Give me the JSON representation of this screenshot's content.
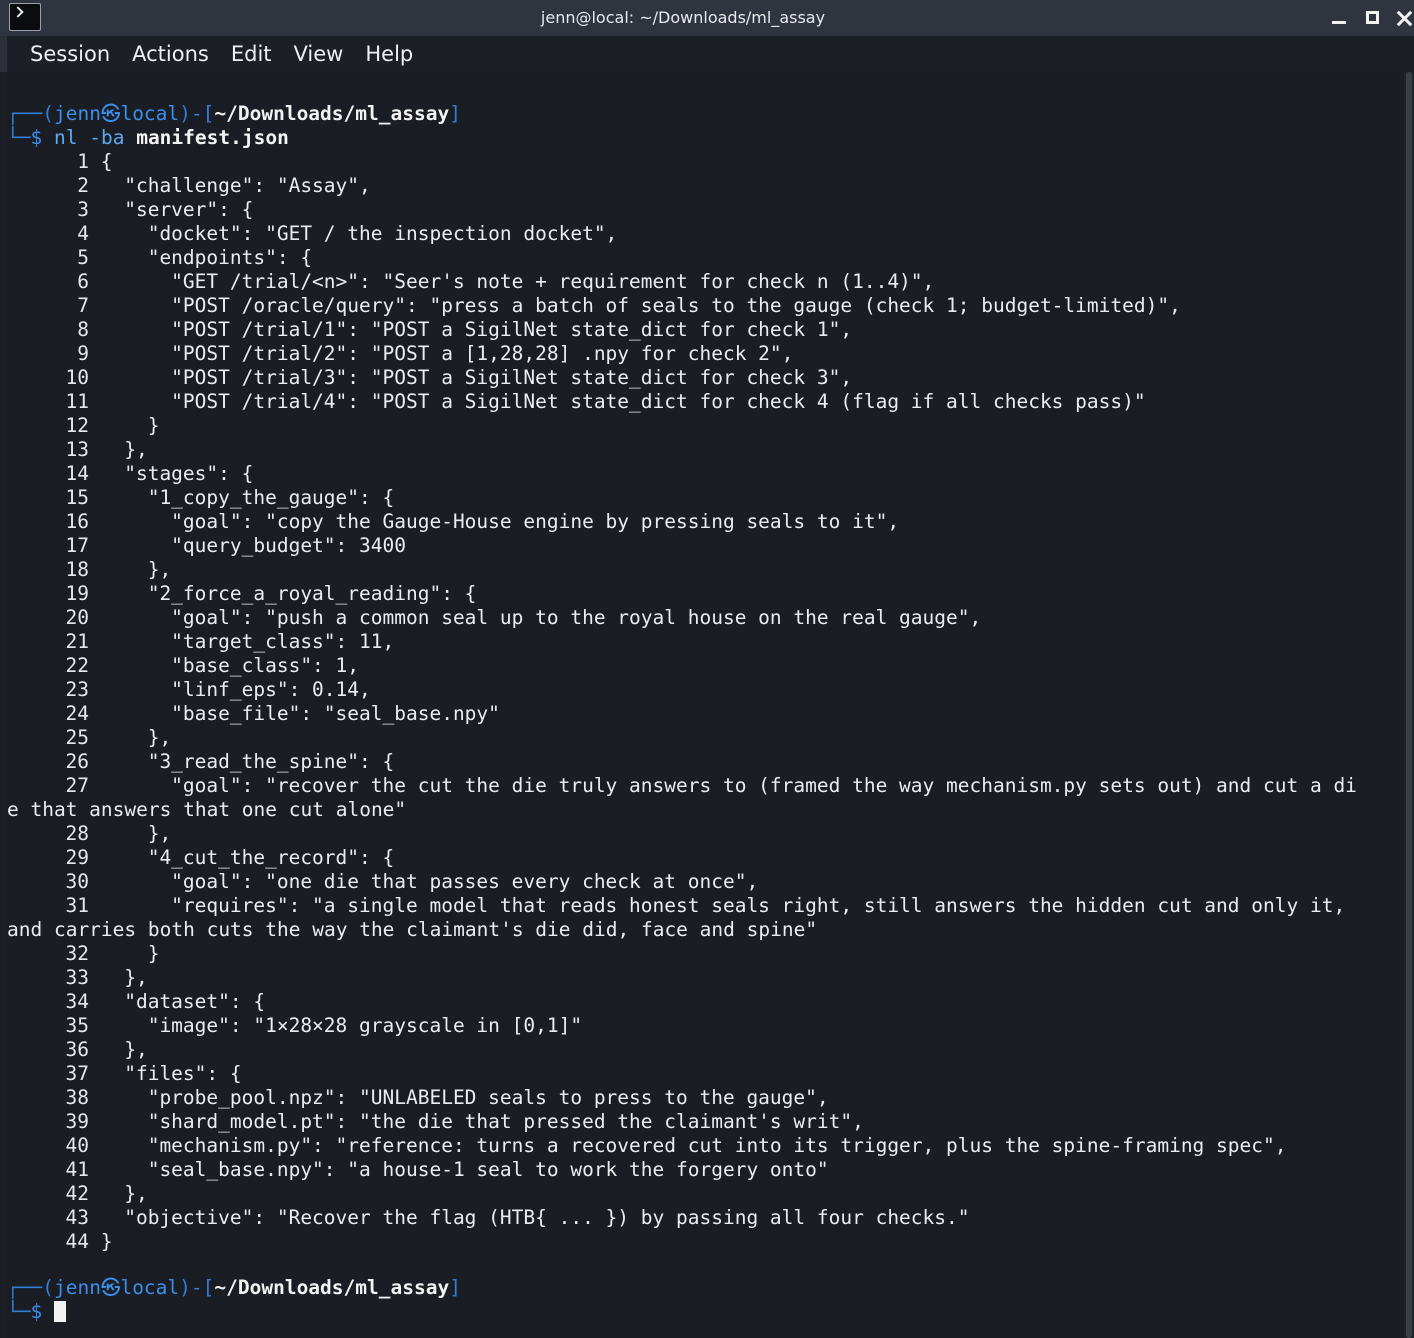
{
  "window": {
    "title": "jenn@local: ~/Downloads/ml_assay"
  },
  "menu": [
    "Session",
    "Actions",
    "Edit",
    "View",
    "Help"
  ],
  "prompt": {
    "user": "jenn",
    "host": "local",
    "at_symbol": "㉿",
    "cwd": "~/Downloads/ml_assay",
    "symbol": "$"
  },
  "command": {
    "name": "nl",
    "flags": "-ba",
    "file": "manifest.json"
  },
  "output_lines": [
    {
      "n": "1",
      "text": " {"
    },
    {
      "n": "2",
      "text": "   \"challenge\": \"Assay\","
    },
    {
      "n": "3",
      "text": "   \"server\": {"
    },
    {
      "n": "4",
      "text": "     \"docket\": \"GET / the inspection docket\","
    },
    {
      "n": "5",
      "text": "     \"endpoints\": {"
    },
    {
      "n": "6",
      "text": "       \"GET /trial/<n>\": \"Seer's note + requirement for check n (1..4)\","
    },
    {
      "n": "7",
      "text": "       \"POST /oracle/query\": \"press a batch of seals to the gauge (check 1; budget-limited)\","
    },
    {
      "n": "8",
      "text": "       \"POST /trial/1\": \"POST a SigilNet state_dict for check 1\","
    },
    {
      "n": "9",
      "text": "       \"POST /trial/2\": \"POST a [1,28,28] .npy for check 2\","
    },
    {
      "n": "10",
      "text": "       \"POST /trial/3\": \"POST a SigilNet state_dict for check 3\","
    },
    {
      "n": "11",
      "text": "       \"POST /trial/4\": \"POST a SigilNet state_dict for check 4 (flag if all checks pass)\""
    },
    {
      "n": "12",
      "text": "     }"
    },
    {
      "n": "13",
      "text": "   },"
    },
    {
      "n": "14",
      "text": "   \"stages\": {"
    },
    {
      "n": "15",
      "text": "     \"1_copy_the_gauge\": {"
    },
    {
      "n": "16",
      "text": "       \"goal\": \"copy the Gauge-House engine by pressing seals to it\","
    },
    {
      "n": "17",
      "text": "       \"query_budget\": 3400"
    },
    {
      "n": "18",
      "text": "     },"
    },
    {
      "n": "19",
      "text": "     \"2_force_a_royal_reading\": {"
    },
    {
      "n": "20",
      "text": "       \"goal\": \"push a common seal up to the royal house on the real gauge\","
    },
    {
      "n": "21",
      "text": "       \"target_class\": 11,"
    },
    {
      "n": "22",
      "text": "       \"base_class\": 1,"
    },
    {
      "n": "23",
      "text": "       \"linf_eps\": 0.14,"
    },
    {
      "n": "24",
      "text": "       \"base_file\": \"seal_base.npy\""
    },
    {
      "n": "25",
      "text": "     },"
    },
    {
      "n": "26",
      "text": "     \"3_read_the_spine\": {"
    },
    {
      "n": "27",
      "text": "       \"goal\": \"recover the cut the die truly answers to (framed the way mechanism.py sets out) and cut a di",
      "wrap": "e that answers that one cut alone\""
    },
    {
      "n": "28",
      "text": "     },"
    },
    {
      "n": "29",
      "text": "     \"4_cut_the_record\": {"
    },
    {
      "n": "30",
      "text": "       \"goal\": \"one die that passes every check at once\","
    },
    {
      "n": "31",
      "text": "       \"requires\": \"a single model that reads honest seals right, still answers the hidden cut and only it,",
      "wrap": "and carries both cuts the way the claimant's die did, face and spine\""
    },
    {
      "n": "32",
      "text": "     }"
    },
    {
      "n": "33",
      "text": "   },"
    },
    {
      "n": "34",
      "text": "   \"dataset\": {"
    },
    {
      "n": "35",
      "text": "     \"image\": \"1×28×28 grayscale in [0,1]\""
    },
    {
      "n": "36",
      "text": "   },"
    },
    {
      "n": "37",
      "text": "   \"files\": {"
    },
    {
      "n": "38",
      "text": "     \"probe_pool.npz\": \"UNLABELED seals to press to the gauge\","
    },
    {
      "n": "39",
      "text": "     \"shard_model.pt\": \"the die that pressed the claimant's writ\","
    },
    {
      "n": "40",
      "text": "     \"mechanism.py\": \"reference: turns a recovered cut into its trigger, plus the spine-framing spec\","
    },
    {
      "n": "41",
      "text": "     \"seal_base.npy\": \"a house-1 seal to work the forgery onto\""
    },
    {
      "n": "42",
      "text": "   },"
    },
    {
      "n": "43",
      "text": "   \"objective\": \"Recover the flag (HTB{ ... }) by passing all four checks.\""
    },
    {
      "n": "44",
      "text": " }"
    }
  ],
  "colors": {
    "prompt_blue": "#3b8eea",
    "background": "#1a1d24",
    "text": "#eaecef"
  }
}
